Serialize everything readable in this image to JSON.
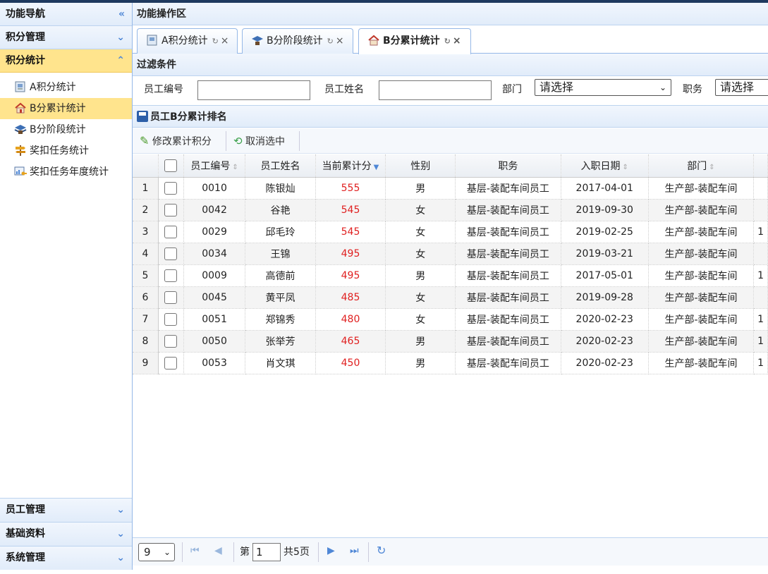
{
  "sidebar": {
    "title": "功能导航",
    "collapse_icon": "double-chevron-left-icon",
    "sections_top": [
      {
        "label": "积分管理",
        "active": false
      },
      {
        "label": "积分统计",
        "active": true
      }
    ],
    "items": [
      {
        "label": "A积分统计",
        "icon": "report-icon",
        "selected": false
      },
      {
        "label": "B分累计统计",
        "icon": "home-icon",
        "selected": true
      },
      {
        "label": "B分阶段统计",
        "icon": "book-stack-icon",
        "selected": false
      },
      {
        "label": "奖扣任务统计",
        "icon": "signpost-icon",
        "selected": false
      },
      {
        "label": "奖扣任务年度统计",
        "icon": "chart-key-icon",
        "selected": false
      }
    ],
    "sections_bottom": [
      {
        "label": "员工管理"
      },
      {
        "label": "基础资料"
      },
      {
        "label": "系统管理"
      }
    ]
  },
  "main": {
    "title": "功能操作区",
    "tabs": [
      {
        "label": "A积分统计",
        "active": false
      },
      {
        "label": "B分阶段统计",
        "active": false
      },
      {
        "label": "B分累计统计",
        "active": true
      }
    ],
    "refresh_glyph": "↻",
    "close_glyph": "×"
  },
  "filter": {
    "title": "过滤条件",
    "emp_no_label": "员工编号",
    "emp_no_value": "",
    "emp_name_label": "员工姓名",
    "emp_name_value": "",
    "dept_label": "部门",
    "dept_value": "请选择",
    "position_label": "职务",
    "position_value": "请选择"
  },
  "grid": {
    "title": "员工B分累计排名",
    "toolbar": {
      "edit_label": "修改累计积分",
      "cancel_label": "取消选中"
    },
    "columns": [
      "员工编号",
      "员工姓名",
      "当前累计分",
      "性别",
      "职务",
      "入职日期",
      "部门"
    ],
    "rows": [
      {
        "n": "1",
        "no": "0010",
        "name": "陈银灿",
        "score": "555",
        "sex": "男",
        "pos": "基层-装配车间员工",
        "date": "2017-04-01",
        "dept": "生产部-装配车间",
        "extra": ""
      },
      {
        "n": "2",
        "no": "0042",
        "name": "谷艳",
        "score": "545",
        "sex": "女",
        "pos": "基层-装配车间员工",
        "date": "2019-09-30",
        "dept": "生产部-装配车间",
        "extra": ""
      },
      {
        "n": "3",
        "no": "0029",
        "name": "邱毛玲",
        "score": "545",
        "sex": "女",
        "pos": "基层-装配车间员工",
        "date": "2019-02-25",
        "dept": "生产部-装配车间",
        "extra": "1"
      },
      {
        "n": "4",
        "no": "0034",
        "name": "王锦",
        "score": "495",
        "sex": "女",
        "pos": "基层-装配车间员工",
        "date": "2019-03-21",
        "dept": "生产部-装配车间",
        "extra": ""
      },
      {
        "n": "5",
        "no": "0009",
        "name": "高德前",
        "score": "495",
        "sex": "男",
        "pos": "基层-装配车间员工",
        "date": "2017-05-01",
        "dept": "生产部-装配车间",
        "extra": "1"
      },
      {
        "n": "6",
        "no": "0045",
        "name": "黄平凤",
        "score": "485",
        "sex": "女",
        "pos": "基层-装配车间员工",
        "date": "2019-09-28",
        "dept": "生产部-装配车间",
        "extra": ""
      },
      {
        "n": "7",
        "no": "0051",
        "name": "郑锦秀",
        "score": "480",
        "sex": "女",
        "pos": "基层-装配车间员工",
        "date": "2020-02-23",
        "dept": "生产部-装配车间",
        "extra": "1"
      },
      {
        "n": "8",
        "no": "0050",
        "name": "张举芳",
        "score": "465",
        "sex": "男",
        "pos": "基层-装配车间员工",
        "date": "2020-02-23",
        "dept": "生产部-装配车间",
        "extra": "1"
      },
      {
        "n": "9",
        "no": "0053",
        "name": "肖文琪",
        "score": "450",
        "sex": "男",
        "pos": "基层-装配车间员工",
        "date": "2020-02-23",
        "dept": "生产部-装配车间",
        "extra": "1"
      }
    ]
  },
  "pager": {
    "page_size": "9",
    "page_prefix": "第",
    "current_page": "1",
    "total_text": "共5页"
  },
  "colors": {
    "accent": "#4f87d6",
    "active_bg": "#ffe48d",
    "score": "#e02020"
  }
}
